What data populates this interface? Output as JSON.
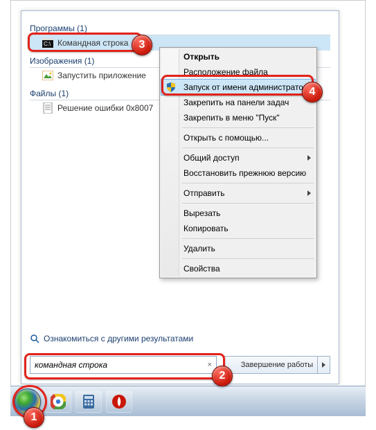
{
  "groups": {
    "programs": {
      "title": "Программы (1)",
      "item": "Командная строка"
    },
    "images": {
      "title": "Изображения (1)",
      "item": "Запустить приложение"
    },
    "files": {
      "title": "Файлы (1)",
      "item": "Решение ошибки 0x8007"
    }
  },
  "more_results": "Ознакомиться с другими результатами",
  "search": {
    "value": "командная строка",
    "clear": "×"
  },
  "shutdown": "Завершение работы",
  "context_menu": {
    "open": "Открыть",
    "open_file_location": "Расположение файла",
    "run_as_admin": "Запуск от имени администратора",
    "pin_taskbar": "Закрепить на панели задач",
    "pin_start": "Закрепить в меню \"Пуск\"",
    "open_with": "Открыть с помощью...",
    "share": "Общий доступ",
    "restore_prev": "Восстановить прежнюю версию",
    "send_to": "Отправить",
    "cut": "Вырезать",
    "copy": "Копировать",
    "delete": "Удалить",
    "properties": "Свойства"
  },
  "badges": {
    "b1": "1",
    "b2": "2",
    "b3": "3",
    "b4": "4"
  }
}
